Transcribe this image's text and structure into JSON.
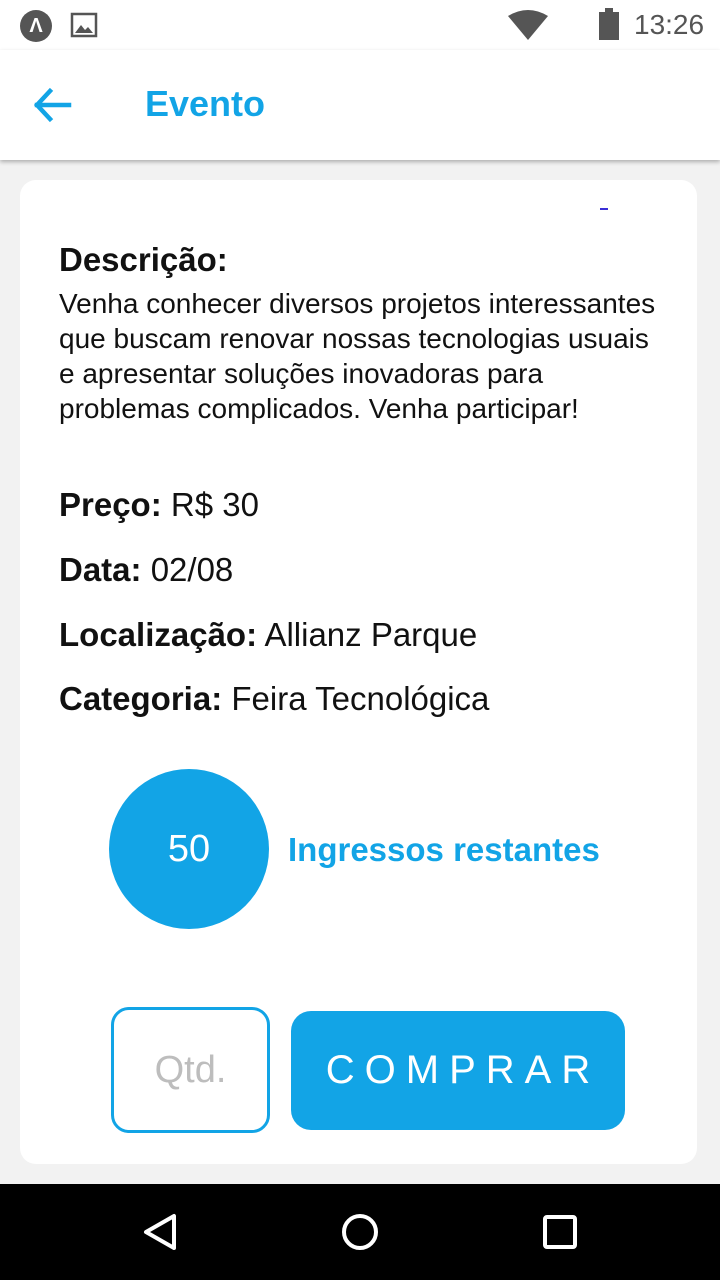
{
  "status_bar": {
    "time": "13:26",
    "app_icon": "launcher-a-icon",
    "app_icon_glyph": "Λ",
    "notification_icon": "image-icon",
    "wifi_icon": "wifi-icon",
    "battery_icon": "battery-icon"
  },
  "app_bar": {
    "back_icon": "arrow-left-icon",
    "title": "Evento"
  },
  "event": {
    "description_label": "Descrição:",
    "description": "Venha conhecer diversos projetos interessantes que buscam renovar nossas tecnologias usuais e apresentar soluções inovadoras para problemas complicados. Venha participar!",
    "price_label": "Preço:",
    "price": "R$ 30",
    "date_label": "Data:",
    "date": "02/08",
    "location_label": "Localização:",
    "location": "Allianz Parque",
    "category_label": "Categoria:",
    "category": "Feira Tecnológica",
    "tickets_remaining_count": "50",
    "tickets_remaining_label": "Ingressos restantes"
  },
  "purchase": {
    "quantity_value": "",
    "quantity_placeholder": "Qtd.",
    "buy_label": "COMPRAR"
  },
  "nav_bar": {
    "back_icon": "triangle-back-icon",
    "home_icon": "circle-home-icon",
    "recents_icon": "square-recents-icon"
  },
  "colors": {
    "accent": "#12a4e6",
    "background": "#f2f2f2",
    "card": "#ffffff",
    "nav_bar": "#000000"
  }
}
